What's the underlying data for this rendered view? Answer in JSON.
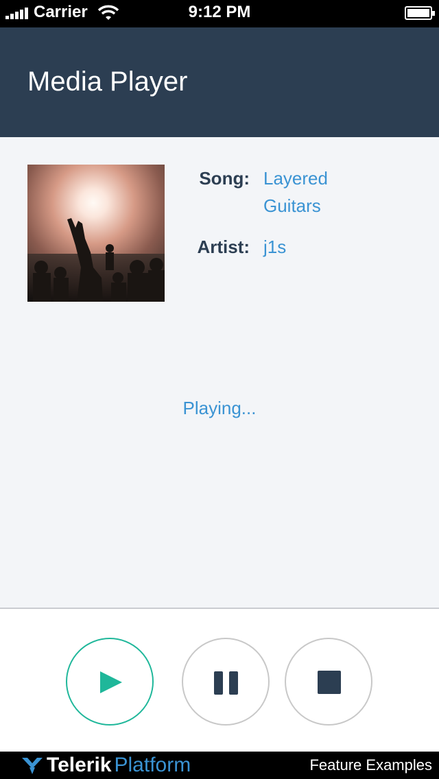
{
  "status_bar": {
    "carrier": "Carrier",
    "time": "9:12 PM"
  },
  "header": {
    "title": "Media Player"
  },
  "track": {
    "song_label": "Song:",
    "song_line1": "Layered",
    "song_line2": "Guitars",
    "artist_label": "Artist:",
    "artist": "j1s"
  },
  "player": {
    "status": "Playing..."
  },
  "controls": {
    "icons": [
      "play-icon",
      "pause-icon",
      "stop-icon"
    ],
    "active_color": "#1fb79a"
  },
  "footer": {
    "brand_main": "Telerik",
    "brand_sub": "Platform",
    "link": "Feature Examples"
  },
  "colors": {
    "header_bg": "#2c3e52",
    "accent_blue": "#3a93d3",
    "accent_green": "#1fb79a"
  }
}
